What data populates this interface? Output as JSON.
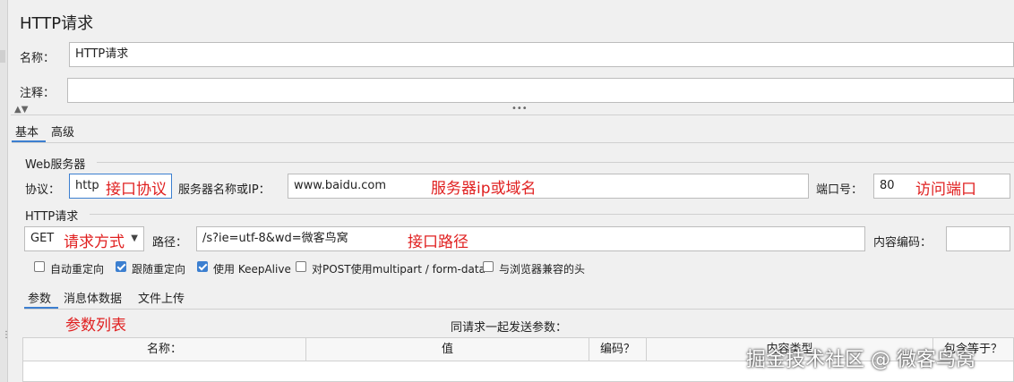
{
  "panel": {
    "title": "HTTP请求",
    "name_label": "名称：",
    "name_value": "HTTP请求",
    "comment_label": "注释：",
    "comment_value": ""
  },
  "tabs": [
    {
      "label": "基本",
      "active": true
    },
    {
      "label": "高级",
      "active": false
    }
  ],
  "web_server": {
    "section_title": "Web服务器",
    "protocol_label": "协议：",
    "protocol_value": "http",
    "protocol_note": "接口协议",
    "server_label": "服务器名称或IP：",
    "server_value": "www.baidu.com",
    "server_note": "服务器ip或域名",
    "port_label": "端口号：",
    "port_value": "80",
    "port_note": "访问端口"
  },
  "http_request": {
    "section_title": "HTTP请求",
    "method_value": "GET",
    "method_note": "请求方式",
    "path_label": "路径：",
    "path_value": "/s?ie=utf-8&wd=微客鸟窝",
    "path_note": "接口路径",
    "encoding_label": "内容编码：",
    "encoding_value": ""
  },
  "options": [
    {
      "label": "自动重定向",
      "checked": false
    },
    {
      "label": "跟随重定向",
      "checked": true
    },
    {
      "label": "使用 KeepAlive",
      "checked": true
    },
    {
      "label": "对POST使用multipart / form-data",
      "checked": false
    },
    {
      "label": "与浏览器兼容的头",
      "checked": false
    }
  ],
  "sub_tabs": [
    {
      "label": "参数",
      "active": true
    },
    {
      "label": "消息体数据",
      "active": false
    },
    {
      "label": "文件上传",
      "active": false
    }
  ],
  "params": {
    "note": "参数列表",
    "caption": "同请求一起发送参数：",
    "columns": [
      "名称：",
      "值",
      "编码？",
      "内容类型",
      "包含等于？"
    ]
  },
  "watermark": "掘金技术社区 @ 微客鸟窝",
  "colors": {
    "annotation": "#e02020",
    "accent": "#3c7fd0"
  }
}
